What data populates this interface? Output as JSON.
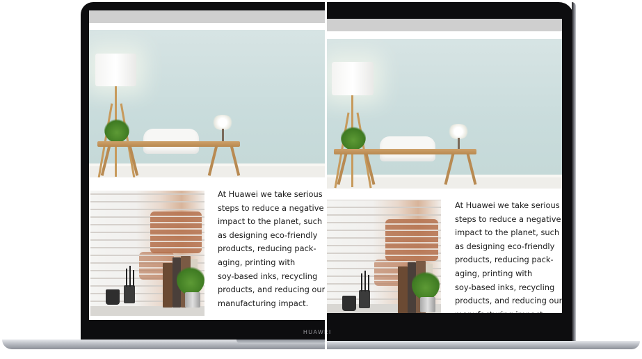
{
  "brand": {
    "label": "HUAWEI"
  },
  "article": {
    "lines": [
      "At Huawei we take serious",
      "steps to reduce a negative",
      "impact to the planet, such",
      "as designing eco-friendly",
      "products, reducing pack-",
      "aging, printing with",
      "soy-based inks, recycling",
      "products, and reducing our",
      "manufacturing impact."
    ]
  },
  "images": {
    "hero": "room-with-desk-lamp-and-chair-photo",
    "detail": "brick-wall-with-books-and-plant-photo"
  },
  "colors": {
    "bezel": "#0d0d0f",
    "toolbar": "#cfcfcf",
    "wall": "#cfe0df",
    "text": "#1a1a1a"
  }
}
